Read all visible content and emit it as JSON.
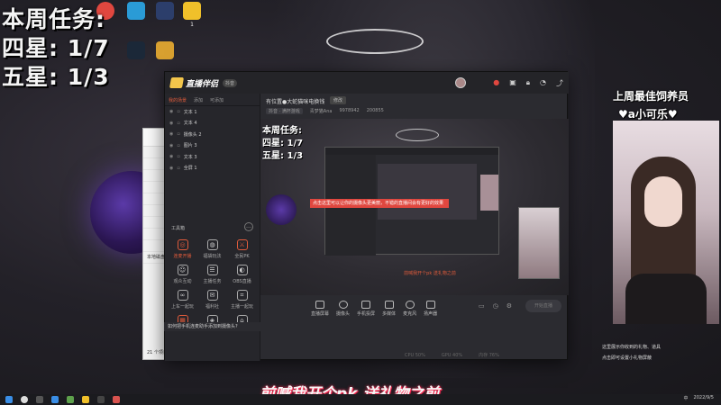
{
  "overlay": {
    "line1": "本周任务:",
    "line2": "四星: 1/7",
    "line3": "五星: 1/3"
  },
  "desktop_icons": [
    {
      "label": "1",
      "color": "#f0c02a"
    }
  ],
  "app": {
    "name": "直播伴侣",
    "version_badge": "抖音",
    "tabs": [
      "我的场景",
      "添加",
      "可添加"
    ],
    "scenes": [
      "文本 1",
      "文本 4",
      "摄像头 2",
      "图片 3",
      "文本 3",
      "全屏 1"
    ],
    "tools_title": "工具箱",
    "tools": [
      "连麦开播",
      "福袋玩法",
      "全民PK",
      "观众互动",
      "主播任务",
      "OBS直播",
      "上车一起玩",
      "福利社",
      "主播一起玩",
      "",
      "",
      ""
    ],
    "room_title": "有位置●大蛇猫咪电换钱",
    "room_edit": "修改",
    "room_meta": [
      "抖音 · 满杯游戏",
      "青梦猫Ana",
      "9978942",
      "200855"
    ],
    "preview_lines": [
      "本周任务:",
      "四星: 1/7",
      "五星: 1/3"
    ],
    "toast": "点击这里可以让你的摄像头更美丽，不错的直播间会有更好的效果",
    "scroll_text": "前喊我开个pk  送礼物之前",
    "bottom_items": [
      "直播屏幕",
      "摄像头",
      "手机投屏",
      "多媒体",
      "麦克风",
      "扬声器"
    ],
    "start_label": "开始直播",
    "status": [
      "CPU 50%",
      "GPU 40%",
      "内存 76%"
    ],
    "notice": "如何把手机连麦助手添加到摄像头?"
  },
  "explorer": {
    "rows": [
      "",
      "",
      "",
      "",
      "",
      "",
      "",
      "",
      "",
      "本地磁盘 (D:)"
    ],
    "footer": "21 个项目"
  },
  "webcam": {
    "caption_line1": "上周最佳饲养员",
    "caption_line2": "♥a小可乐♥",
    "note1": "这里展示你收到的礼物、道具",
    "note2": "点击即可设置小礼物屏蔽"
  },
  "subtitle": "前喊我开个pk   送礼物之前",
  "taskbar": {
    "time": "2022/9/5",
    "tray_label": "中"
  }
}
